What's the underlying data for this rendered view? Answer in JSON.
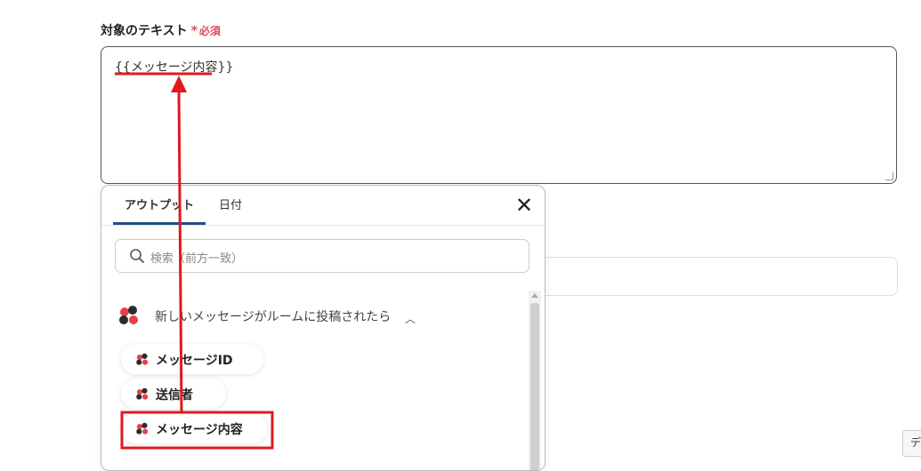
{
  "form": {
    "field_label": "対象のテキスト",
    "required_star": "*",
    "required_text": "必須",
    "textarea_value": "{{メッセージ内容}}"
  },
  "corner_tab": {
    "text": "デ"
  },
  "popup": {
    "tabs": [
      {
        "label": "アウトプット",
        "active": true
      },
      {
        "label": "日付",
        "active": false
      }
    ],
    "close_icon": "close-icon",
    "search": {
      "placeholder": "検索（前方一致）",
      "icon": "search-icon"
    },
    "trigger": {
      "label": "新しいメッセージがルームに投稿されたら",
      "icon": "chatwork-logo",
      "expanded": true
    },
    "outputs": [
      {
        "label": "メッセージID"
      },
      {
        "label": "送信者"
      },
      {
        "label": "メッセージ内容",
        "highlighted": true
      }
    ]
  },
  "colors": {
    "accent_tab": "#1f4f82",
    "required": "#e04b5a",
    "annotation_red": "#e0191e",
    "logo_red": "#e8404b",
    "logo_dark": "#2b2b2b"
  }
}
